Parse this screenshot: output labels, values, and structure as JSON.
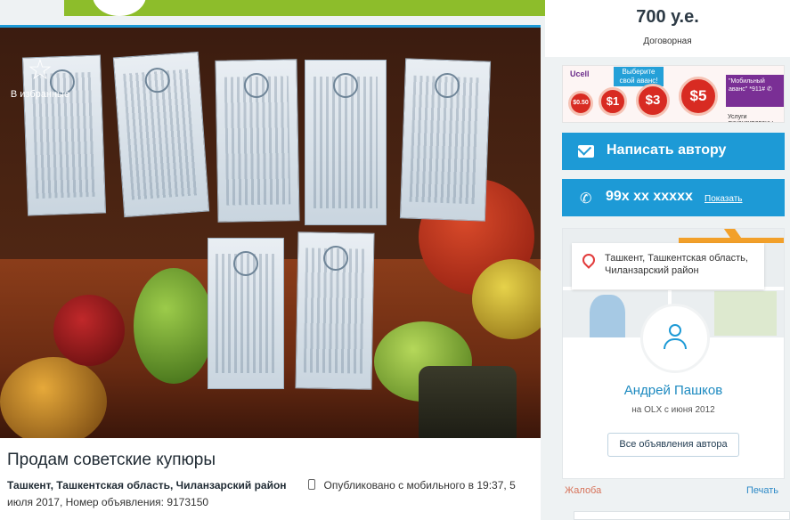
{
  "ad": {
    "title": "Продам советские купюры",
    "location": "Ташкент, Ташкентская область, Чиланзарский район",
    "meta": "Опубликовано с мобильного  в 19:37, 5 июля 2017, Номер объявления: 9173150"
  },
  "favorites": {
    "icon": "star-icon",
    "label": "В избранные"
  },
  "price": {
    "value": "700 у.е.",
    "note": "Договорная"
  },
  "banner_ad": {
    "brand": "Ucell",
    "bubble": "Выберите свой аванс!",
    "amounts": [
      "$0.50",
      "$1",
      "$3",
      "$5"
    ],
    "side_text": "\"Мобильный аванс\" *911# ✆",
    "footer": "Услуги лицензированы"
  },
  "contact": {
    "write_label": "Написать автору",
    "phone_number": "99x xx xxxxx",
    "show_label": "Показать"
  },
  "author": {
    "location": "Ташкент, Ташкентская область, Чиланзарский район",
    "name": "Андрей Пашков",
    "since": "на OLX с июня 2012",
    "all_ads_label": "Все объявления автора"
  },
  "footer_links": {
    "report": "Жалоба",
    "print": "Печать"
  },
  "colors": {
    "accent": "#1d9ad6",
    "banner": "#8dbd2b",
    "report": "#d7735a"
  }
}
